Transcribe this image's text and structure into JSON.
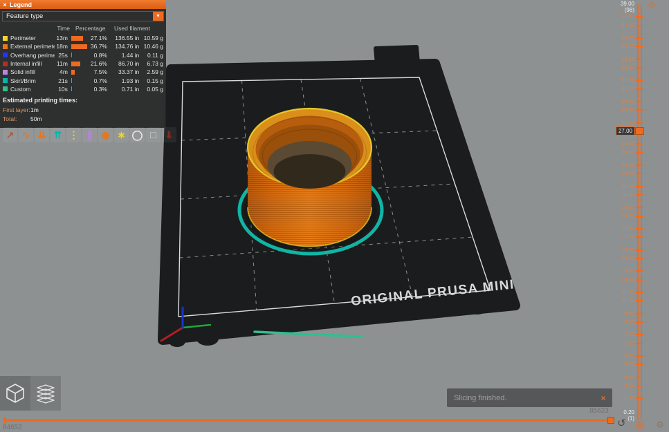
{
  "colors": {
    "accent": "#ED6B21",
    "background": "#8E9192",
    "bed": "#1A1C1D"
  },
  "legend": {
    "title": "Legend",
    "close_glyph": "×",
    "view_select_value": "Feature type",
    "dropdown_glyph": "▼",
    "columns": {
      "time": "Time",
      "percentage": "Percentage",
      "used_filament": "Used filament"
    },
    "rows": [
      {
        "name": "Perimeter",
        "color": "#EED52A",
        "time": "13m",
        "percent": "27.1%",
        "percent_value": 27.1,
        "length": "136.55 in",
        "weight": "10.59 g"
      },
      {
        "name": "External perimeter",
        "color": "#E8761B",
        "time": "18m",
        "percent": "36.7%",
        "percent_value": 36.7,
        "length": "134.76 in",
        "weight": "10.46 g"
      },
      {
        "name": "Overhang perimeter",
        "color": "#2036FF",
        "time": "25s",
        "percent": "0.8%",
        "percent_value": 0.8,
        "length": "1.44 in",
        "weight": "0.11 g"
      },
      {
        "name": "Internal infill",
        "color": "#AF3224",
        "time": "11m",
        "percent": "21.6%",
        "percent_value": 21.6,
        "length": "86.70 in",
        "weight": "6.73 g"
      },
      {
        "name": "Solid infill",
        "color": "#B886DD",
        "time": "4m",
        "percent": "7.5%",
        "percent_value": 7.5,
        "length": "33.37 in",
        "weight": "2.59 g"
      },
      {
        "name": "Skirt/Brim",
        "color": "#00B7B0",
        "time": "21s",
        "percent": "0.7%",
        "percent_value": 0.7,
        "length": "1.93 in",
        "weight": "0.15 g"
      },
      {
        "name": "Custom",
        "color": "#2FBF8E",
        "time": "10s",
        "percent": "0.3%",
        "percent_value": 0.3,
        "length": "0.71 in",
        "weight": "0.05 g"
      }
    ],
    "estimated_title": "Estimated printing times:",
    "first_layer_label": "First layer:",
    "first_layer_value": "1m",
    "total_label": "Total:",
    "total_value": "50m"
  },
  "toolbar": {
    "icons": [
      {
        "name": "travel-icon",
        "glyph": "↗",
        "color": "#B3573B"
      },
      {
        "name": "wipe-icon",
        "glyph": "∿",
        "color": "#E8761B"
      },
      {
        "name": "retractions-icon",
        "glyph": "⇊",
        "color": "#E8761B"
      },
      {
        "name": "deretractions-icon",
        "glyph": "⇈",
        "color": "#00B7B0"
      },
      {
        "name": "seams-icon",
        "glyph": "⋮",
        "color": "#EED52A"
      },
      {
        "name": "tool-changes-icon",
        "glyph": "∥",
        "color": "#B886DD"
      },
      {
        "name": "color-changes-icon",
        "glyph": "◉",
        "color": "#E8761B"
      },
      {
        "name": "custom-gcodes-icon",
        "glyph": "∗",
        "color": "#EED52A"
      },
      {
        "name": "shells-icon",
        "glyph": "◯",
        "color": "#ECECEC"
      },
      {
        "name": "tool-marker-icon",
        "glyph": "□",
        "color": "#D8D8D8"
      },
      {
        "name": "legend-toggle-icon",
        "glyph": "⇓",
        "color": "#8B2F20"
      }
    ]
  },
  "scene": {
    "bed_label": "ORIGINAL PRUSA MINI"
  },
  "vertical_slider": {
    "top_value": "39.00",
    "top_layer": "(98)",
    "current_value": "27.00",
    "bottom_value": "0.20",
    "bottom_layer": "(1)",
    "gear_glyph": "⚙",
    "tick_values": [
      "37.80",
      "37.00",
      "35.80",
      "35.00",
      "33.80",
      "33.00",
      "31.80",
      "31.00",
      "29.80",
      "29.00",
      "27.80",
      "25.80",
      "25.00",
      "23.80",
      "23.00",
      "21.80",
      "21.00",
      "19.80",
      "19.00",
      "17.80",
      "17.00",
      "15.80",
      "15.00",
      "13.80",
      "13.00",
      "11.80",
      "11.00",
      "9.80",
      "9.00",
      "7.80",
      "7.00",
      "5.80",
      "5.00",
      "3.80",
      "3.00",
      "1.80"
    ]
  },
  "horizontal_slider": {
    "left_value": "84652",
    "right_value": "85623"
  },
  "notification": {
    "text": "Slicing finished.",
    "close_glyph": "×"
  },
  "corner": {
    "undo_glyph": "↺",
    "doc_glyph": "▤",
    "gear_glyph": "⚙"
  }
}
